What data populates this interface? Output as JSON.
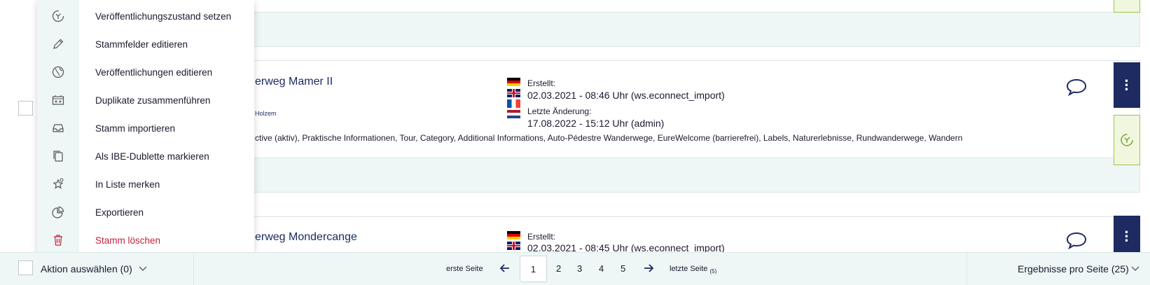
{
  "menu": {
    "items": [
      {
        "label": "Veröffentlichungszustand setzen",
        "icon": "publish-state-icon"
      },
      {
        "label": "Stammfelder editieren",
        "icon": "pencil-icon"
      },
      {
        "label": "Veröffentlichungen editieren",
        "icon": "globe-icon"
      },
      {
        "label": "Duplikate zusammenführen",
        "icon": "merge-duplicates-icon"
      },
      {
        "label": "Stamm importieren",
        "icon": "inbox-import-icon"
      },
      {
        "label": "Als IBE-Dublette markieren",
        "icon": "copy-mark-icon"
      },
      {
        "label": "In Liste merken",
        "icon": "star-pin-icon"
      },
      {
        "label": "Exportieren",
        "icon": "pie-chart-icon"
      },
      {
        "label": "Stamm löschen",
        "icon": "trash-icon"
      }
    ]
  },
  "rows": [
    {
      "title_visible": "erweg Mamer II",
      "place_visible": "Holzem",
      "categories_visible": "ctive (aktiv), Praktische Informationen, Tour, Category, Additional Informations, Auto-Pédestre Wanderwege, EureWelcome (barrierefrei), Labels, Naturerlebnisse, Rundwanderwege, Wandern",
      "created_label": "Erstellt:",
      "created_value": "02.03.2021 - 08:46 Uhr (ws.econnect_import)",
      "modified_label": "Letzte Änderung:",
      "modified_value": "17.08.2022 - 15:12 Uhr (admin)"
    },
    {
      "title_visible": "erweg Mondercange",
      "created_label": "Erstellt:",
      "created_value": "02.03.2021 - 08:45 Uhr (ws.econnect_import)"
    }
  ],
  "footer": {
    "action_label": "Aktion auswählen (0)",
    "first_page": "erste Seite",
    "last_page": "letzte Seite",
    "last_page_count": "(5)",
    "current_page": "1",
    "pages": [
      "2",
      "3",
      "4",
      "5"
    ],
    "per_page": "Ergebnisse pro Seite (25)"
  },
  "colors": {
    "accent_navy": "#1d2b62",
    "strip_bg": "#eef7f6",
    "state_green": "#9ec44b",
    "danger": "#c0233e"
  }
}
